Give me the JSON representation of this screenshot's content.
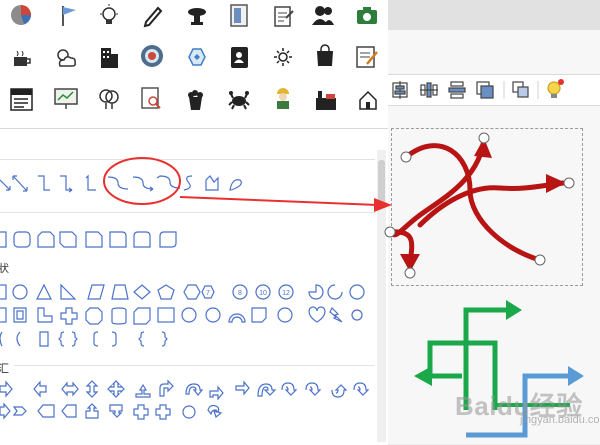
{
  "categories": {
    "basic_shapes_label": "状",
    "arrows_label": "汇"
  },
  "watermark": {
    "main": "Baidu经验",
    "sub": "jingyan.baidu.com"
  },
  "colors": {
    "shape_outline": "#4a72c8",
    "arrow_red": "#b81414",
    "arrow_green": "#1aa84a",
    "arrow_blue": "#5b9bd5",
    "annotation_red": "#e8312e"
  },
  "icons": {
    "row1": [
      "pie-chart-icon",
      "flag-icon",
      "lightbulb-icon",
      "pencil-icon",
      "server-icon",
      "door-icon",
      "clipboard-icon",
      "users-icon",
      "camera-icon"
    ],
    "row2": [
      "coffee-icon",
      "cloud-sun-icon",
      "building-icon",
      "target-icon",
      "hexagon-icon",
      "contact-card-icon",
      "sun-icon",
      "shopping-bag-icon",
      "note-edit-icon"
    ],
    "row3": [
      "sale-sign-icon",
      "presentation-icon",
      "brain-icon",
      "document-search-icon",
      "popcorn-icon",
      "crab-icon",
      "worker-icon",
      "factory-icon",
      "house-icon"
    ]
  },
  "toolbar_icons": [
    "align-center-icon",
    "distribute-horizontal-icon",
    "distribute-vertical-icon",
    "bring-front-icon",
    "group-icon",
    "idea-bulb-icon"
  ]
}
